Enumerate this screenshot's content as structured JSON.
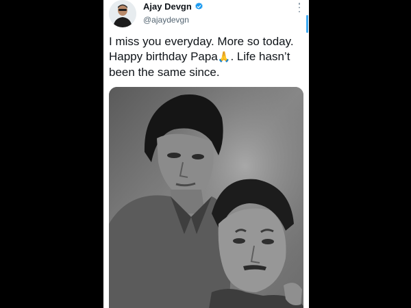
{
  "tweet": {
    "author_name": "Ajay Devgn",
    "author_handle": "@ajaydevgn",
    "text_line1": "I miss you everyday. More so today.",
    "text_line2a": "Happy birthday Papa",
    "text_emoji": "🙏",
    "text_line2b": ". Life hasn’t",
    "text_line3": "been the same since."
  },
  "icons": {
    "verified": "verified-badge-icon",
    "more": "more-options-icon"
  },
  "colors": {
    "background": "#000000",
    "card": "#ffffff",
    "text": "#0f1419",
    "secondary_text": "#536471",
    "verified_blue": "#1d9bf0"
  }
}
